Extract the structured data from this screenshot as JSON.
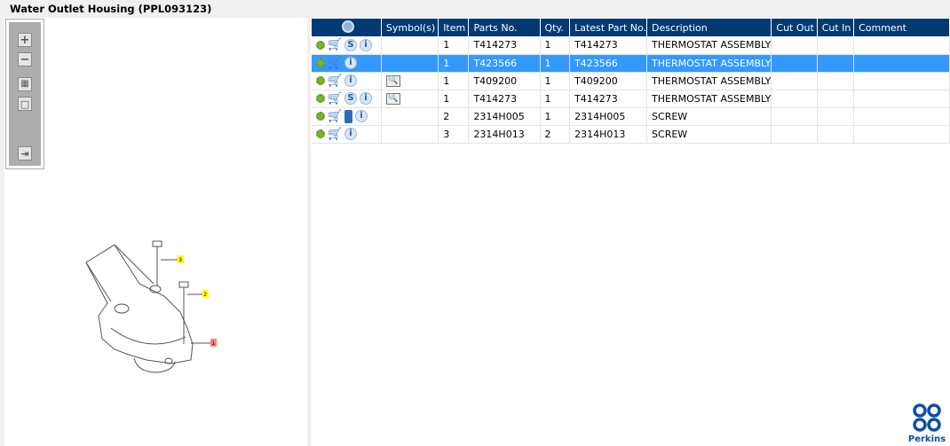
{
  "title": "Water Outlet Housing (PPL093123)",
  "toolbar": {
    "zoom_in": "+",
    "zoom_out": "−",
    "fit": "▦",
    "actual": "□",
    "export": "⇥"
  },
  "table": {
    "columns": [
      "",
      "Symbol(s)",
      "Item",
      "Parts No.",
      "Qty.",
      "Latest Part No.",
      "Description",
      "Cut Out",
      "Cut In",
      "Comment"
    ],
    "rows": [
      {
        "icons": [
          "gear-icon",
          "cart-icon",
          "s-icon",
          "info-icon"
        ],
        "symbol": "",
        "item": "1",
        "parts_no": "T414273",
        "qty": "1",
        "latest": "T414273",
        "description": "THERMOSTAT ASSEMBLY",
        "cut_out": "",
        "cut_in": "",
        "comment": ""
      },
      {
        "icons": [
          "gear-icon",
          "cart-icon",
          "info-icon"
        ],
        "symbol": "",
        "item": "1",
        "parts_no": "T423566",
        "qty": "1",
        "latest": "T423566",
        "description": "THERMOSTAT ASSEMBLY",
        "cut_out": "",
        "cut_in": "",
        "comment": "",
        "selected": true
      },
      {
        "icons": [
          "gear-icon",
          "cart-icon",
          "info-icon"
        ],
        "symbol": "manual-icon",
        "item": "1",
        "parts_no": "T409200",
        "qty": "1",
        "latest": "T409200",
        "description": "THERMOSTAT ASSEMBLY",
        "cut_out": "",
        "cut_in": "",
        "comment": ""
      },
      {
        "icons": [
          "gear-icon",
          "cart-icon",
          "s-icon",
          "info-icon"
        ],
        "symbol": "manual-icon",
        "item": "1",
        "parts_no": "T414273",
        "qty": "1",
        "latest": "T414273",
        "description": "THERMOSTAT ASSEMBLY",
        "cut_out": "",
        "cut_in": "",
        "comment": ""
      },
      {
        "icons": [
          "gear-icon",
          "cart-icon",
          "book-icon",
          "info-icon"
        ],
        "symbol": "",
        "item": "2",
        "parts_no": "2314H005",
        "qty": "1",
        "latest": "2314H005",
        "description": "SCREW",
        "cut_out": "",
        "cut_in": "",
        "comment": ""
      },
      {
        "icons": [
          "gear-icon",
          "cart-icon",
          "info-icon"
        ],
        "symbol": "",
        "item": "3",
        "parts_no": "2314H013",
        "qty": "2",
        "latest": "2314H013",
        "description": "SCREW",
        "cut_out": "",
        "cut_in": "",
        "comment": ""
      }
    ]
  },
  "callouts": [
    "1",
    "2",
    "3"
  ],
  "logo": "Perkins",
  "colors": {
    "header": "#023a73",
    "selected": "#3399ff",
    "callout_yellow": "#ffff00",
    "callout_red": "#ff8080"
  }
}
